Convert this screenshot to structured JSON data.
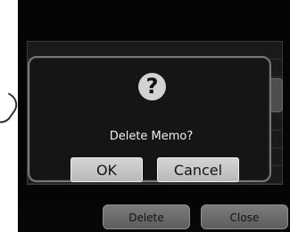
{
  "screen": {
    "top_title": "",
    "memo_meta_left": "",
    "memo_meta_right": ""
  },
  "dialog": {
    "icon": "?",
    "message": "Delete Memo?",
    "ok_label": "OK",
    "cancel_label": "Cancel"
  },
  "bottom_bar": {
    "delete_label": "Delete",
    "close_label": "Close"
  },
  "icons": {
    "dialog_icon": "question-circle-icon"
  }
}
